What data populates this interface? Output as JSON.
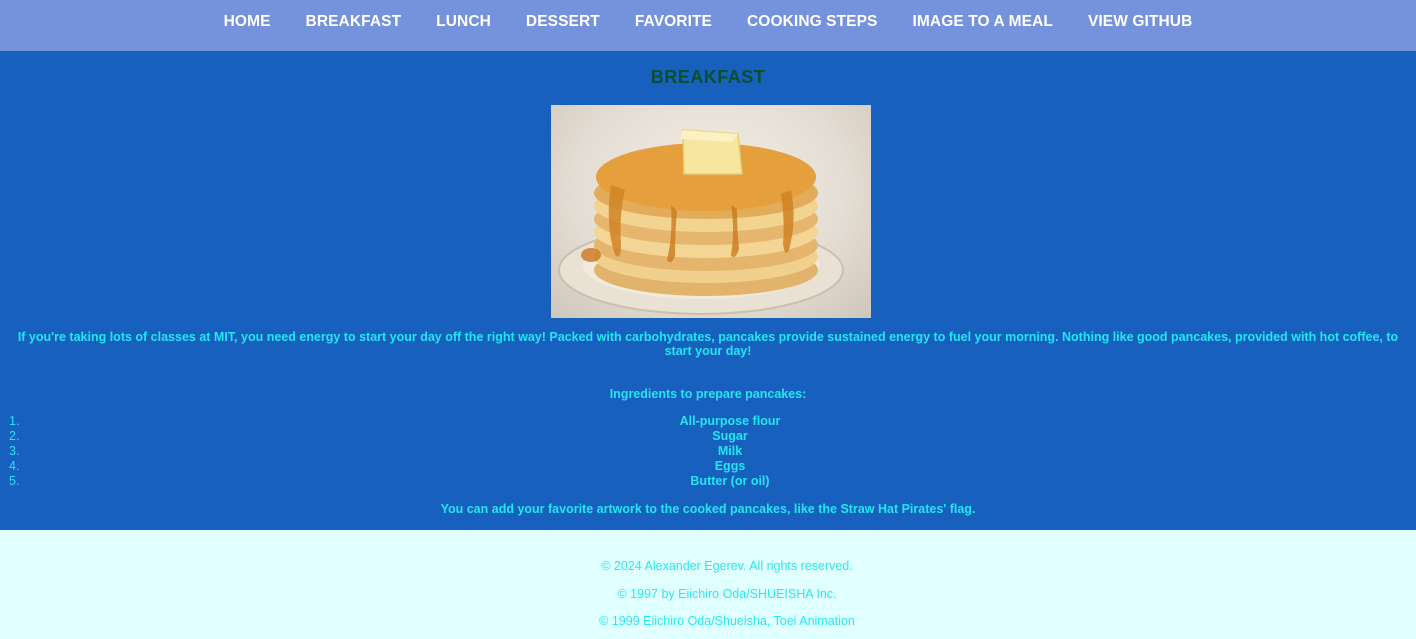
{
  "nav": [
    "HOME",
    "BREAKFAST",
    "LUNCH",
    "DESSERT",
    "FAVORITE",
    "COOKING STEPS",
    "IMAGE TO A MEAL",
    "VIEW GITHUB"
  ],
  "page": {
    "title": "BREAKFAST",
    "image_alt": "pancakes-photo",
    "intro": "If you're taking lots of classes at MIT, you need energy to start your day off the right way! Packed with carbohydrates, pancakes provide sustained energy to fuel your morning. Nothing like good pancakes, provided with hot coffee, to start your day!",
    "ingredients_title": "Ingredients to prepare pancakes:",
    "ingredients": [
      {
        "num": "1.",
        "text": "All-purpose flour"
      },
      {
        "num": "2.",
        "text": "Sugar"
      },
      {
        "num": "3.",
        "text": "Milk"
      },
      {
        "num": "4.",
        "text": "Eggs"
      },
      {
        "num": "5.",
        "text": "Butter (or oil)"
      }
    ],
    "closing": "You can add your favorite artwork to the cooked pancakes, like the Straw Hat Pirates' flag."
  },
  "footer": [
    "© 2024 Alexander Egerev. All rights reserved.",
    "© 1997 by Eiichiro Oda/SHUEISHA Inc.",
    "© 1999 Eiichiro Oda/Shueisha, Toei Animation"
  ],
  "colors": {
    "nav_bg": "#7592dc",
    "main_bg": "#1760be",
    "text_cyan": "#22e6f2",
    "title_green": "#0c4f2e",
    "footer_bg": "#e0ffff"
  }
}
